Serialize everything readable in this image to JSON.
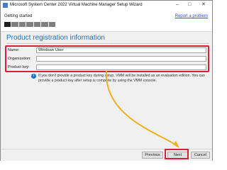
{
  "window": {
    "title": "Microsoft System Center 2022 Virtual Machine Manager Setup Wizard",
    "controls": [
      "–",
      "□",
      "✕"
    ]
  },
  "header": {
    "step_label": "Getting started",
    "report_link": "Report a problem",
    "progress": {
      "segments": 7,
      "completed": 1
    }
  },
  "section": {
    "title": "Product registration information"
  },
  "form": {
    "name_label": "Name:",
    "name_value": "Windows User",
    "org_label": "Organization:",
    "org_value": "",
    "key_label": "Product key:",
    "key_value": ""
  },
  "info": {
    "icon": "info-icon",
    "text": "If you don't provide a product key during setup, VMM will be installed as an evaluation edition. You can provide a product key after setup is complete by using the VMM console."
  },
  "buttons": {
    "previous": "Previous",
    "next": "Next",
    "cancel": "Cancel"
  },
  "colors": {
    "accent": "#1b6fc4",
    "highlight": "#d81f3a",
    "arrow": "#f0b020"
  }
}
